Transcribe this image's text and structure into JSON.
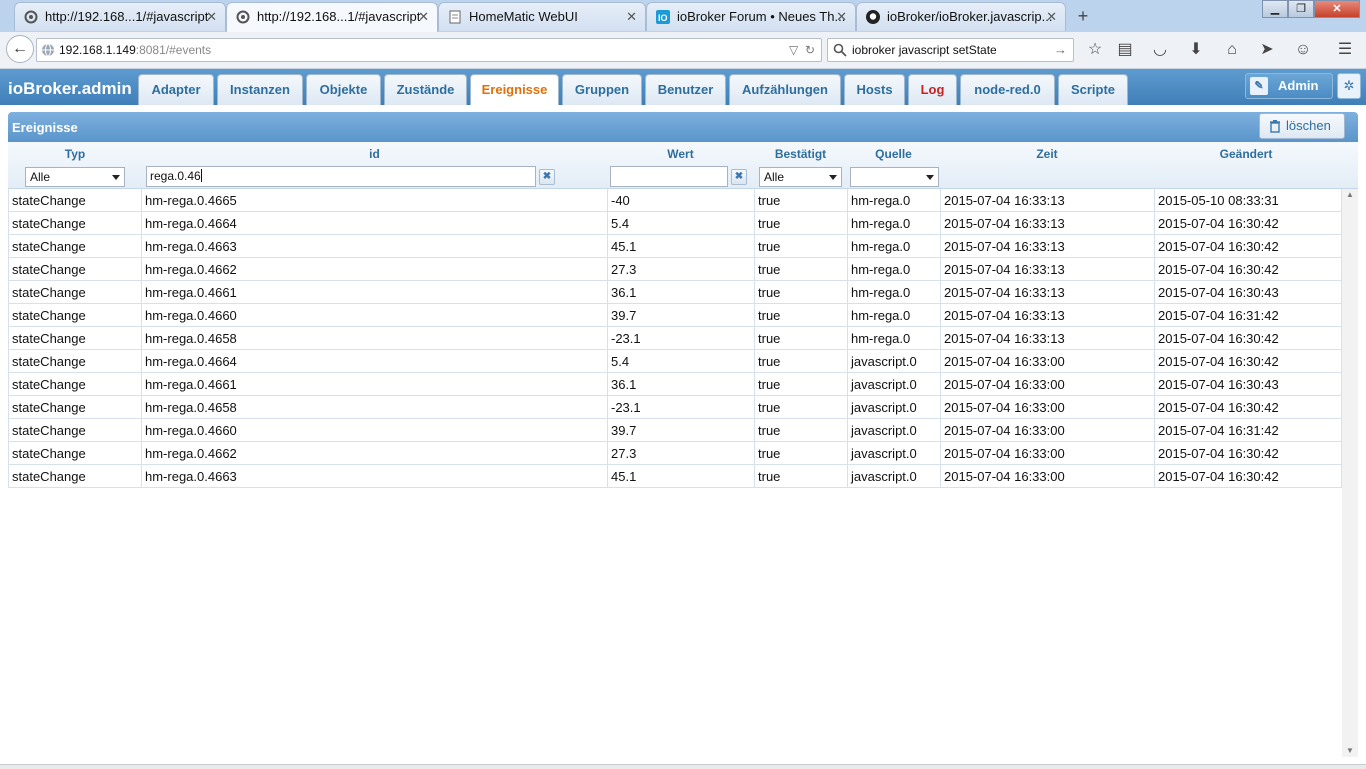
{
  "browser": {
    "tabs": [
      {
        "label": "http://192.168...1/#javascript",
        "icon": "gear-icon"
      },
      {
        "label": "http://192.168...1/#javascript",
        "icon": "gear-icon"
      },
      {
        "label": "HomeMatic WebUI",
        "icon": "page-icon"
      },
      {
        "label": "ioBroker Forum • Neues Th...",
        "icon": "iobroker-forum-icon"
      },
      {
        "label": "ioBroker/ioBroker.javascrip...",
        "icon": "github-icon"
      }
    ],
    "active_tab_index": 1,
    "address": {
      "host": "192.168.1.149",
      "rest": ":8081/#events"
    },
    "search_value": "iobroker javascript setState"
  },
  "app": {
    "brand": "ioBroker.admin",
    "tabs": [
      "Adapter",
      "Instanzen",
      "Objekte",
      "Zustände",
      "Ereignisse",
      "Gruppen",
      "Benutzer",
      "Aufzählungen",
      "Hosts",
      "Log",
      "node-red.0",
      "Scripte"
    ],
    "active_tab": "Ereignisse",
    "user_label": "Admin",
    "accent_color": "#e17009",
    "log_color": "#cc1f1f"
  },
  "panel": {
    "title": "Ereignisse",
    "clear_label": "löschen",
    "columns": [
      "Typ",
      "id",
      "Wert",
      "Bestätigt",
      "Quelle",
      "Zeit",
      "Geändert"
    ],
    "filters": {
      "typ": "Alle",
      "id": "rega.0.46",
      "wert": "",
      "bestaetigt": "Alle",
      "quelle": ""
    },
    "rows": [
      [
        "stateChange",
        "hm-rega.0.4665",
        "-40",
        "true",
        "hm-rega.0",
        "2015-07-04 16:33:13",
        "2015-05-10 08:33:31"
      ],
      [
        "stateChange",
        "hm-rega.0.4664",
        "5.4",
        "true",
        "hm-rega.0",
        "2015-07-04 16:33:13",
        "2015-07-04 16:30:42"
      ],
      [
        "stateChange",
        "hm-rega.0.4663",
        "45.1",
        "true",
        "hm-rega.0",
        "2015-07-04 16:33:13",
        "2015-07-04 16:30:42"
      ],
      [
        "stateChange",
        "hm-rega.0.4662",
        "27.3",
        "true",
        "hm-rega.0",
        "2015-07-04 16:33:13",
        "2015-07-04 16:30:42"
      ],
      [
        "stateChange",
        "hm-rega.0.4661",
        "36.1",
        "true",
        "hm-rega.0",
        "2015-07-04 16:33:13",
        "2015-07-04 16:30:43"
      ],
      [
        "stateChange",
        "hm-rega.0.4660",
        "39.7",
        "true",
        "hm-rega.0",
        "2015-07-04 16:33:13",
        "2015-07-04 16:31:42"
      ],
      [
        "stateChange",
        "hm-rega.0.4658",
        "-23.1",
        "true",
        "hm-rega.0",
        "2015-07-04 16:33:13",
        "2015-07-04 16:30:42"
      ],
      [
        "stateChange",
        "hm-rega.0.4664",
        "5.4",
        "true",
        "javascript.0",
        "2015-07-04 16:33:00",
        "2015-07-04 16:30:42"
      ],
      [
        "stateChange",
        "hm-rega.0.4661",
        "36.1",
        "true",
        "javascript.0",
        "2015-07-04 16:33:00",
        "2015-07-04 16:30:43"
      ],
      [
        "stateChange",
        "hm-rega.0.4658",
        "-23.1",
        "true",
        "javascript.0",
        "2015-07-04 16:33:00",
        "2015-07-04 16:30:42"
      ],
      [
        "stateChange",
        "hm-rega.0.4660",
        "39.7",
        "true",
        "javascript.0",
        "2015-07-04 16:33:00",
        "2015-07-04 16:31:42"
      ],
      [
        "stateChange",
        "hm-rega.0.4662",
        "27.3",
        "true",
        "javascript.0",
        "2015-07-04 16:33:00",
        "2015-07-04 16:30:42"
      ],
      [
        "stateChange",
        "hm-rega.0.4663",
        "45.1",
        "true",
        "javascript.0",
        "2015-07-04 16:33:00",
        "2015-07-04 16:30:42"
      ]
    ]
  }
}
